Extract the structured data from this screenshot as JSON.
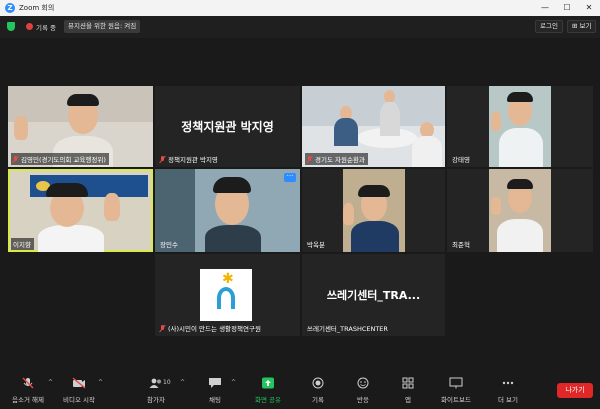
{
  "window": {
    "title": "Zoom 회의",
    "logo_letter": "Z",
    "min": "—",
    "max": "☐",
    "close": "✕"
  },
  "topbar": {
    "record_label": "기록 중",
    "speaker_view_label": "뮤지션을 위한 원음: 켜짐",
    "login_label": "로그인",
    "view_label": "보기"
  },
  "tiles": [
    {
      "name": "김영민(경기도의회 교육행정위)",
      "muted": true
    },
    {
      "name": "정책지원관 박지영",
      "display_name": "정책지원관 박지영",
      "muted": true
    },
    {
      "name": "경기도 자원순환과",
      "muted": true
    },
    {
      "name": "강태영",
      "muted": false
    },
    {
      "name": "이지향",
      "muted": false,
      "active": true
    },
    {
      "name": "장민수",
      "muted": false
    },
    {
      "name": "박옥분",
      "muted": false
    },
    {
      "name": "최준혁",
      "muted": false
    },
    {
      "name": "(사)시민이 만드는 생활정책연구원",
      "muted": true
    },
    {
      "name": "쓰레기센터_TRASHCENTER",
      "display_name": "쓰레기센터_TRA...",
      "muted": false
    }
  ],
  "toolbar": {
    "unmute": "음소거 해제",
    "start_video": "비디오 시작",
    "participants": "참가자",
    "participants_count": "10",
    "chat": "채팅",
    "share_screen": "화면 공유",
    "record": "기록",
    "reactions": "반응",
    "apps": "앱",
    "whiteboard": "화이트보드",
    "more": "더 보기",
    "leave": "나가기"
  },
  "colors": {
    "accent": "#2d8cff",
    "share_green": "#23c55e",
    "leave_red": "#e02828",
    "active_border": "#d9e84a"
  }
}
